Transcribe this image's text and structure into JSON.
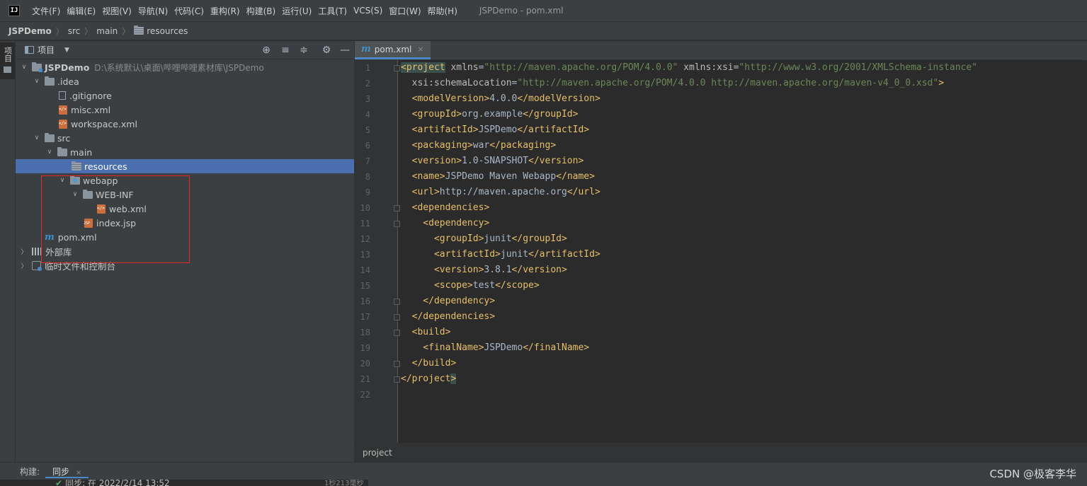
{
  "menubar": {
    "logo": "IJ",
    "items": [
      "文件(F)",
      "编辑(E)",
      "视图(V)",
      "导航(N)",
      "代码(C)",
      "重构(R)",
      "构建(B)",
      "运行(U)",
      "工具(T)",
      "VCS(S)",
      "窗口(W)",
      "帮助(H)"
    ],
    "window_title": "JSPDemo - pom.xml"
  },
  "breadcrumb": {
    "project": "JSPDemo",
    "sep": "〉",
    "items": [
      "src",
      "main",
      "resources"
    ]
  },
  "left_stripe": {
    "label": "项目"
  },
  "project_panel": {
    "title": "项目",
    "dropdown_icon": "▼",
    "tools": [
      "⊕",
      "≡",
      "≑",
      "⚙",
      "—"
    ],
    "tree": [
      {
        "label": "JSPDemo",
        "hint": "D:\\系统默认\\桌面\\哔哩哔哩素材库\\JSPDemo",
        "chev": "∨",
        "icon": "module-folder-icon"
      },
      {
        "label": ".idea",
        "chev": "∨",
        "icon": "folder-icon"
      },
      {
        "label": ".gitignore",
        "icon": "text-file-icon"
      },
      {
        "label": "misc.xml",
        "icon": "xml-file-icon"
      },
      {
        "label": "workspace.xml",
        "icon": "xml-file-icon"
      },
      {
        "label": "src",
        "chev": "∨",
        "icon": "folder-icon"
      },
      {
        "label": "main",
        "chev": "∨",
        "icon": "folder-icon"
      },
      {
        "label": "resources",
        "icon": "resources-folder-icon",
        "selected": true
      },
      {
        "label": "webapp",
        "chev": "∨",
        "icon": "web-folder-icon"
      },
      {
        "label": "WEB-INF",
        "chev": "∨",
        "icon": "folder-icon"
      },
      {
        "label": "web.xml",
        "icon": "xml-file-icon"
      },
      {
        "label": "index.jsp",
        "icon": "jsp-file-icon"
      },
      {
        "label": "pom.xml",
        "icon": "maven-icon"
      },
      {
        "label": "外部库",
        "chev": "〉",
        "icon": "library-icon"
      },
      {
        "label": "临时文件和控制台",
        "chev": "〉",
        "icon": "scratch-icon"
      }
    ]
  },
  "editor": {
    "tab_label": "pom.xml",
    "tab_close": "×",
    "line_numbers": [
      "1",
      "2",
      "3",
      "4",
      "5",
      "6",
      "7",
      "8",
      "9",
      "10",
      "11",
      "12",
      "13",
      "14",
      "15",
      "16",
      "17",
      "18",
      "19",
      "20",
      "21",
      "22"
    ],
    "code": {
      "l1_tag_open": "<project",
      "l1_attr1": " xmlns",
      "l1_eq1": "=",
      "l1_val1": "\"http://maven.apache.org/POM/4.0.0\"",
      "l1_attr2": " xmlns:xsi",
      "l1_eq2": "=",
      "l1_val2": "\"http://www.w3.org/2001/XMLSchema-instance\"",
      "l2_attr": "  xsi:schemaLocation",
      "l2_eq": "=",
      "l2_val": "\"http://maven.apache.org/POM/4.0.0 http://maven.apache.org/maven-v4_0_0.xsd\"",
      "l2_close": ">",
      "l3_open": "  <modelVersion>",
      "l3_text": "4.0.0",
      "l3_close": "</modelVersion>",
      "l4_open": "  <groupId>",
      "l4_text": "org.example",
      "l4_close": "</groupId>",
      "l5_open": "  <artifactId>",
      "l5_text": "JSPDemo",
      "l5_close": "</artifactId>",
      "l6_open": "  <packaging>",
      "l6_text": "war",
      "l6_close": "</packaging>",
      "l7_open": "  <version>",
      "l7_text": "1.0-SNAPSHOT",
      "l7_close": "</version>",
      "l8_open": "  <name>",
      "l8_text": "JSPDemo Maven Webapp",
      "l8_close": "</name>",
      "l9_open": "  <url>",
      "l9_text": "http://maven.apache.org",
      "l9_close": "</url>",
      "l10": "  <dependencies>",
      "l11": "    <dependency>",
      "l12_open": "      <groupId>",
      "l12_text": "junit",
      "l12_close": "</groupId>",
      "l13_open": "      <artifactId>",
      "l13_text": "junit",
      "l13_close": "</artifactId>",
      "l14_open": "      <version>",
      "l14_text": "3.8.1",
      "l14_close": "</version>",
      "l15_open": "      <scope>",
      "l15_text": "test",
      "l15_close": "</scope>",
      "l16": "    </dependency>",
      "l17": "  </dependencies>",
      "l18": "  <build>",
      "l19_open": "    <finalName>",
      "l19_text": "JSPDemo",
      "l19_close": "</finalName>",
      "l20": "  </build>",
      "l21_a": "</project",
      "l21_b": ">"
    },
    "breadcrumb": "project"
  },
  "bottom": {
    "build_label": "构建:",
    "sync_tab": "同步",
    "sync_close": "×",
    "row_text": "同步: 在 2022/2/14 13:52",
    "row_time": "1秒213毫秒",
    "watermark": "CSDN @极客李华"
  },
  "colors": {
    "tag": "#e8bf6a",
    "attr_value": "#6a8759",
    "selection": "#4b6eaf",
    "highlight_box": "#e62b2b"
  }
}
